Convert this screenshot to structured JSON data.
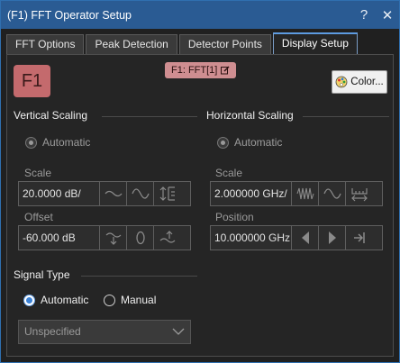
{
  "window": {
    "title": "(F1) FFT Operator Setup",
    "help_label": "?",
    "close_label": "✕"
  },
  "tabs": [
    {
      "label": "FFT Options"
    },
    {
      "label": "Peak Detection"
    },
    {
      "label": "Detector Points"
    },
    {
      "label": "Display Setup",
      "active": true
    }
  ],
  "header": {
    "badge": "F1",
    "chip": "F1: FFT[1]",
    "color_button": "Color..."
  },
  "vertical": {
    "title": "Vertical Scaling",
    "automatic": "Automatic",
    "scale_label": "Scale",
    "scale_value": "20.0000 dB/",
    "offset_label": "Offset",
    "offset_value": "-60.000 dB"
  },
  "horizontal": {
    "title": "Horizontal Scaling",
    "automatic": "Automatic",
    "scale_label": "Scale",
    "scale_value": "2.000000 GHz/",
    "position_label": "Position",
    "position_value": "10.000000 GHz"
  },
  "signal_type": {
    "title": "Signal Type",
    "options": [
      "Automatic",
      "Manual"
    ],
    "selected": "Automatic",
    "dropdown_value": "Unspecified"
  },
  "colors": {
    "titlebar": "#2a5b93",
    "badge": "#c46a6d",
    "chip": "#cf8e91",
    "accent": "#3b82d6"
  }
}
